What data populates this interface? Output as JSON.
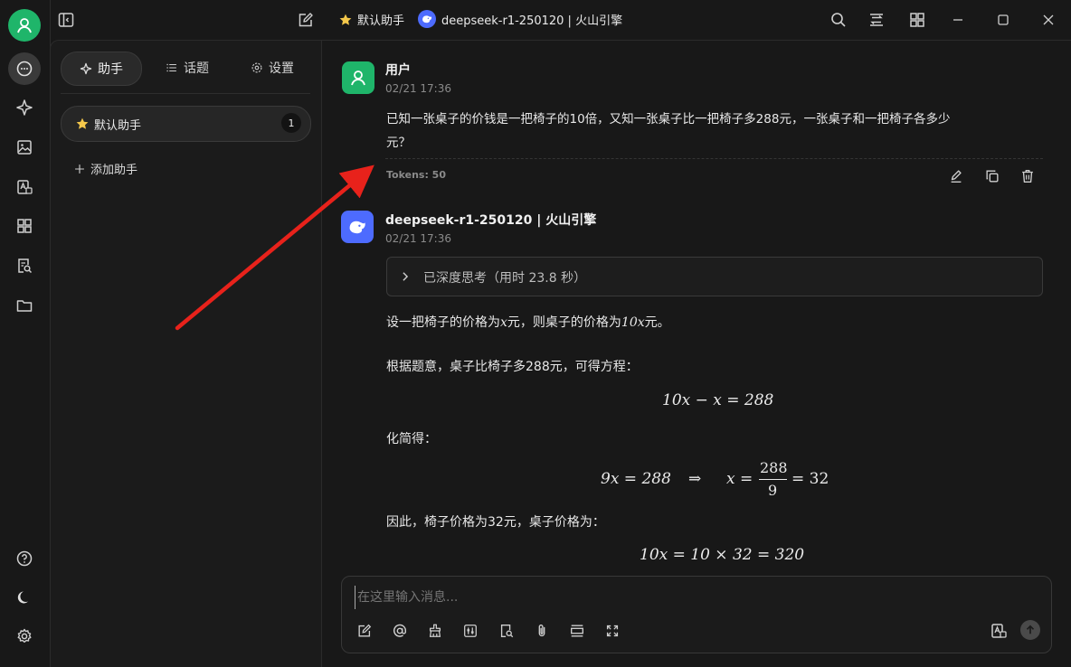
{
  "header": {
    "assistant_label": "默认助手",
    "model_label": "deepseek-r1-250120 | 火山引擎"
  },
  "sidebar": {
    "tabs": [
      {
        "label": "助手"
      },
      {
        "label": "话题"
      },
      {
        "label": "设置"
      }
    ],
    "assistant": {
      "name": "默认助手",
      "count": "1"
    },
    "add_label": "添加助手"
  },
  "messages": {
    "user": {
      "name": "用户",
      "time": "02/21 17:36",
      "text_line1": "已知一张桌子的价钱是一把椅子的10倍，又知一张桌子比一把椅子多288元，一张桌子和一把椅子各多少",
      "text_line2": "元？",
      "tokens": "Tokens: 50"
    },
    "assistant": {
      "name": "deepseek-r1-250120 | 火山引擎",
      "time": "02/21 17:36",
      "thinking": "已深度思考（用时 23.8 秒）",
      "p1_prefix": "设一把椅子的价格为",
      "p1_var": "x",
      "p1_mid": "元，则桌子的价格为",
      "p1_var2": "10x",
      "p1_suffix": "元。",
      "p2": "根据题意，桌子比椅子多288元，可得方程：",
      "eq1": "10x − x = 288",
      "p3": "化简得：",
      "eq2_left": "9x = 288",
      "eq2_arrow": "⇒",
      "eq2_x": "x =",
      "eq2_num": "288",
      "eq2_den": "9",
      "eq2_right": "= 32",
      "p4": "因此，椅子价格为32元，桌子价格为：",
      "eq3": "10x = 10 × 32 = 320"
    }
  },
  "input": {
    "placeholder": "在这里输入消息..."
  },
  "colors": {
    "background": "#181818",
    "user_avatar": "#1fb56a",
    "model_avatar": "#4d6bfe",
    "annotation_arrow": "#e8221b"
  },
  "icons": {
    "rail": [
      "avatar-icon",
      "chat-icon",
      "sparkle-icon",
      "image-icon",
      "translate-icon",
      "apps-icon",
      "doc-search-icon",
      "folder-icon",
      "help-icon",
      "moon-icon",
      "gear-icon"
    ],
    "toolbar": [
      "edit-icon",
      "at-icon",
      "broom-icon",
      "sliders-icon",
      "doc-search-icon",
      "paperclip-icon",
      "page-break-icon",
      "expand-icon",
      "translate-icon",
      "send-icon"
    ]
  }
}
